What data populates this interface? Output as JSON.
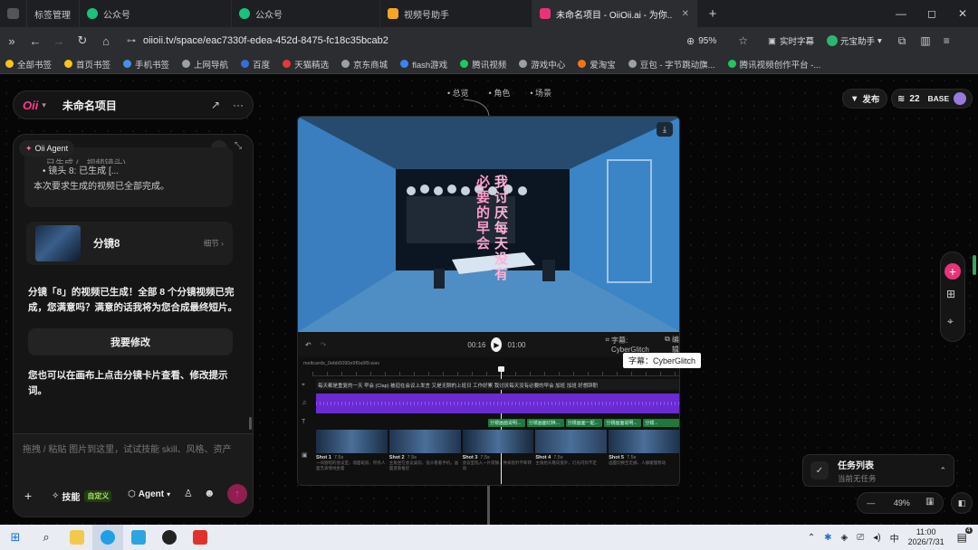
{
  "tabs": [
    {
      "label": "标签管理",
      "color": "#8a8a8a"
    },
    {
      "label": "公众号",
      "color": "#19c37d"
    },
    {
      "label": "公众号",
      "color": "#19c37d"
    },
    {
      "label": "视频号助手",
      "color": "#f5a623"
    },
    {
      "label": "未命名项目 - OiiOii.ai - 为你..",
      "color": "#e8337a"
    }
  ],
  "window": {
    "new_tab": "+",
    "minimize": "—",
    "maximize": "◻",
    "close": "✕"
  },
  "address": {
    "url": "oiioii.tv/space/eac7330f-edea-452d-8475-fc18c35bcab2",
    "zoom": "95%",
    "caption_btn": "实时字幕",
    "assistant_btn": "元宝助手"
  },
  "bookmarks": [
    {
      "label": "全部书签",
      "color": "#f5c518"
    },
    {
      "label": "首页书签",
      "color": "#f5c518"
    },
    {
      "label": "手机书签",
      "color": "#4a90e2"
    },
    {
      "label": "上网导航",
      "color": "#9aa0a6"
    },
    {
      "label": "百度",
      "color": "#3b6bd6"
    },
    {
      "label": "天猫精选",
      "color": "#e23b3b"
    },
    {
      "label": "京东商城",
      "color": "#9aa0a6"
    },
    {
      "label": "flash游戏",
      "color": "#3b82f6"
    },
    {
      "label": "腾讯视频",
      "color": "#22c55e"
    },
    {
      "label": "游戏中心",
      "color": "#9aa0a6"
    },
    {
      "label": "爱淘宝",
      "color": "#f97316"
    },
    {
      "label": "豆包 - 字节跳动旗...",
      "color": "#9aa0a6"
    },
    {
      "label": "腾讯视频创作平台 -...",
      "color": "#22c55e"
    }
  ],
  "header": {
    "logo": "Oii",
    "project_title": "未命名项目",
    "share_icon": "↗",
    "more": "···"
  },
  "topnav": {
    "items": [
      "总览",
      "角色",
      "场景"
    ]
  },
  "topright": {
    "publish": "发布",
    "credits": "22",
    "plan": "BASE"
  },
  "agent": {
    "tag": "Oii Agent",
    "prev_line1": "已生成 (...视频镜头)",
    "prev_line2": "镜头 8: 已生成 [...",
    "prev_done": "本次要求生成的视频已全部完成。",
    "card_title": "分镜8",
    "card_detail": "细节",
    "msg1": "分镜「8」的视频已生成！全部 8 个分镜视频已完成，您满意吗？满意的话我将为您合成最终短片。",
    "modify_btn": "我要修改",
    "msg2": "您也可以在画布上点击分镜卡片查看、修改提示词。",
    "input_placeholder": "拖拽 / 粘贴 图片到这里，试试技能 skill、风格、资产",
    "skill_label": "技能",
    "custom_badge": "自定义",
    "agent_label": "Agent"
  },
  "video": {
    "caption_left": "必要的早会",
    "caption_right": "我讨厌每天没有",
    "time_current": "00:16",
    "time_total": "01:00",
    "subtitle_btn": "字幕: CyberGlitch",
    "edit_btn": "编辑",
    "tooltip": "字幕：CyberGlitch",
    "track_name": "meltcards_0ebb5090e9f0a9f9.wav",
    "timeline_text": "每天都是重复的一天  早会  (Clap)  被迫在会议上发言  又是无聊的上班日  工作好累  我讨厌每天没有必要的早会  加班 加班  好想辞职",
    "shots": [
      {
        "label": "Shot 1",
        "dur": "7.5s",
        "desc": "一间昏暗的会议室，墙面斑驳，所有人面无表情地坐着"
      },
      {
        "label": "Shot 2",
        "dur": "7.5s",
        "desc": "主角坐在会议桌前，低头看着手机，画面逐渐推近"
      },
      {
        "label": "Shot 3",
        "dur": "7.5s",
        "desc": "会议室陷入一片寂静，钟表指针不断转动"
      },
      {
        "label": "Shot 4",
        "dur": "7.5s",
        "desc": "主角抬头看向窗外，灯光闪烁不定"
      },
      {
        "label": "Shot 5",
        "dur": "7.5s",
        "desc": "画面切换至走廊，人群缓慢移动"
      }
    ],
    "clip_labels": [
      "分镜画面说明...",
      "分镜画面切换...",
      "分镜画面一起...",
      "分镜画面说明...",
      "分镜..."
    ]
  },
  "tasks": {
    "title": "任务列表",
    "status": "当前无任务"
  },
  "zoom": {
    "minus": "—",
    "value": "49%",
    "plus": "+"
  },
  "taskbar": {
    "time": "11:00",
    "date": "2026/7/31",
    "ime": "中",
    "notify": "4"
  }
}
